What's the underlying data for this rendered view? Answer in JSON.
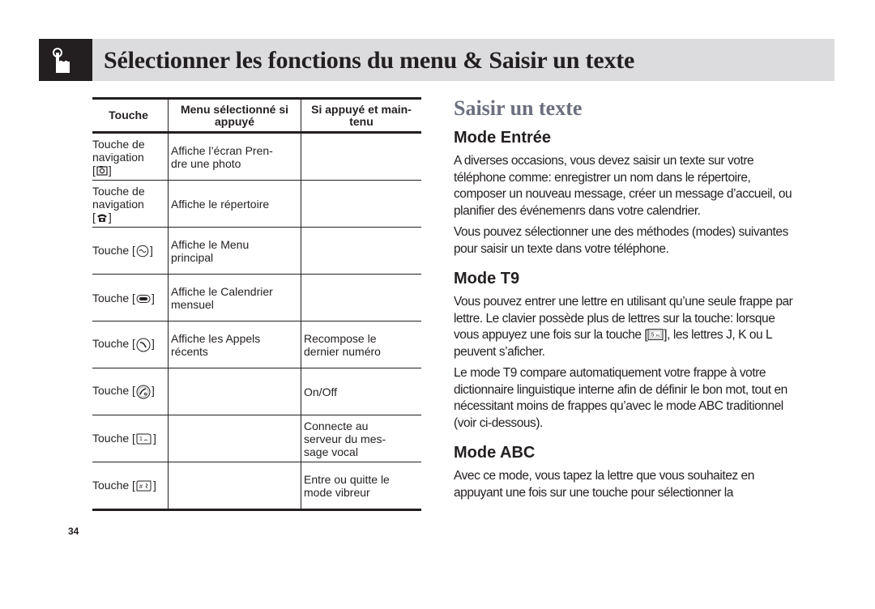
{
  "header": {
    "icon": "hand-pointer-icon",
    "title": "Sélectionner les fonctions du menu & Saisir un texte"
  },
  "table": {
    "columns": [
      "Touche",
      "Menu sélectionné si appuyé",
      "Si appuyé et main-\ntenu"
    ],
    "rows": [
      {
        "key_label": "Touche de\nnavigation",
        "key_icon": "camera-key-icon",
        "pressed": "Affiche l’écran Pren-\ndre une photo",
        "held": ""
      },
      {
        "key_label": "Touche de\nnavigation",
        "key_icon": "phonebook-key-icon",
        "pressed": "Affiche le répertoire",
        "held": ""
      },
      {
        "key_label": "Touche",
        "key_icon": "menu-key-icon",
        "pressed": "Affiche le Menu\nprincipal",
        "held": ""
      },
      {
        "key_label": "Touche",
        "key_icon": "calendar-key-icon",
        "pressed": "Affiche le Calendrier\nmensuel",
        "held": ""
      },
      {
        "key_label": "Touche",
        "key_icon": "send-key-icon",
        "pressed": "Affiche les Appels\nrécents",
        "held": "Recompose le\ndernier numéro"
      },
      {
        "key_label": "Touche",
        "key_icon": "power-end-key-icon",
        "pressed": "",
        "held": "On/Off"
      },
      {
        "key_label": "Touche",
        "key_icon": "key-1-voicemail-icon",
        "pressed": "",
        "held": "Connecte au\nserveur du mes-\nsage vocal"
      },
      {
        "key_label": "Touche",
        "key_icon": "hash-key-vibrate-icon",
        "pressed": "",
        "held": "Entre ou quitte le\nmode vibreur"
      }
    ]
  },
  "page_number": "34",
  "content": {
    "section_title": "Saisir un texte",
    "mode_entree": {
      "heading": "Mode Entrée",
      "paragraphs": [
        "A diverses occasions, vous devez saisir un texte sur votre téléphone comme: enregistrer un nom dans le répertoire, composer un nouveau message, créer un message d’accueil, ou planifier des événemenrs dans votre calendrier.",
        "Vous pouvez sélectionner une des méthodes (modes) suivantes pour saisir un texte dans votre téléphone."
      ]
    },
    "mode_t9": {
      "heading": "Mode T9",
      "p1_before_key": "Vous pouvez entrer une lettre en utilisant qu’une seule frappe par lettre. Le clavier possède plus de lettres sur la touche: lorsque vous appuyez une fois sur la touche [",
      "p1_key_icon": "key-5-jkl-icon",
      "p1_after_key": "], les lettres J, K ou L peuvent s’aficher.",
      "p2": "Le mode T9 compare automatiquement votre frappe à votre dictionnaire linguistique interne afin de définir le bon mot, tout en nécessitant moins de frappes qu’avec le mode ABC traditionnel (voir ci-dessous)."
    },
    "mode_abc": {
      "heading": "Mode ABC",
      "paragraph": "Avec ce mode, vous tapez la lettre que vous souhaitez en appuyant une fois sur une touche pour sélectionner la"
    }
  }
}
